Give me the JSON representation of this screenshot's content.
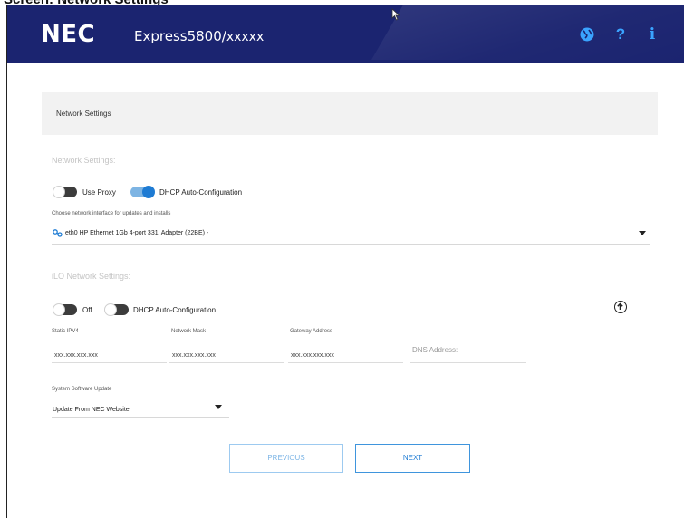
{
  "caption": {
    "text": "Screen: Network Settings"
  },
  "header": {
    "logo": "NEC",
    "product_name": "Express5800/",
    "product_suffix": "xxxxx",
    "icons": [
      "globe-icon",
      "help-icon",
      "info-icon"
    ],
    "help_glyph": "?",
    "info_glyph": "i",
    "accent": "#1b2470",
    "icon_color": "#3aa3ff"
  },
  "section": {
    "title": "Network Settings"
  },
  "network": {
    "heading": "Network Settings:",
    "use_proxy": {
      "label": "Use Proxy",
      "on": false
    },
    "dhcp": {
      "label": "DHCP Auto-Configuration",
      "on": true
    },
    "interface_hint": "Choose network interface for updates and installs",
    "interface_value": "eth0 HP Ethernet 1Gb 4-port 331i Adapter (22BE) -"
  },
  "ilo": {
    "heading": "iLO Network Settings:",
    "off": {
      "label": "Off",
      "on": false
    },
    "dhcp": {
      "label": "DHCP Auto-Configuration",
      "on": false
    },
    "fields": {
      "static_ipv4": {
        "label": "Static IPV4",
        "value": "xxx.xxx.xxx.xxx"
      },
      "network_mask": {
        "label": "Network Mask",
        "value": "xxx.xxx.xxx.xxx"
      },
      "gateway": {
        "label": "Gateway Address",
        "value": "xxx.xxx.xxx.xxx"
      },
      "dns": {
        "label": "DNS Address:"
      }
    }
  },
  "software_update": {
    "label": "System Software Update",
    "value": "Update From NEC Website"
  },
  "buttons": {
    "previous": "PREVIOUS",
    "next": "NEXT"
  }
}
